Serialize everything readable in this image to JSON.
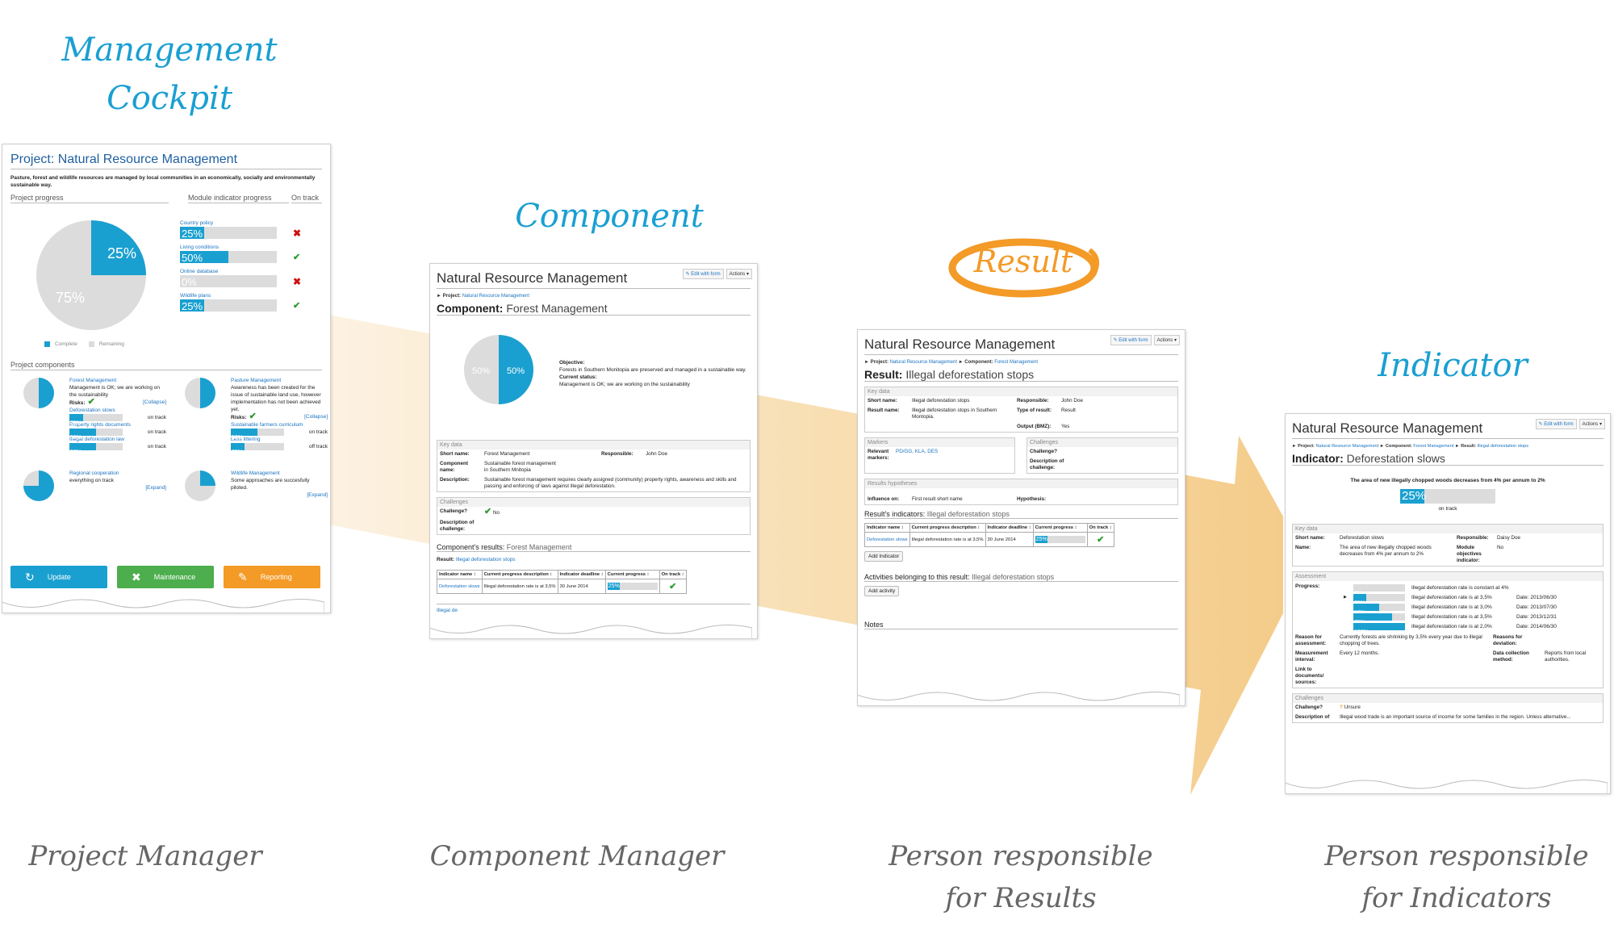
{
  "stages": {
    "management_cockpit": "Management\nCockpit",
    "management_cockpit_line1": "Management",
    "management_cockpit_line2": "Cockpit",
    "component": "Component",
    "result": "Result",
    "indicator": "Indicator"
  },
  "roles": {
    "project_manager": "Project Manager",
    "component_manager": "Component Manager",
    "results_line1": "Person responsible",
    "results_line2": "for Results",
    "indicators_line1": "Person responsible",
    "indicators_line2": "for Indicators"
  },
  "colors": {
    "accent_blue": "#1aa0d0",
    "result_orange": "#f39a27",
    "arrow_fill": "#f6d9a6",
    "update_button": "#1aa0d0",
    "maintenance_button": "#4cae4c",
    "reporting_button": "#f39a27"
  },
  "cockpit": {
    "title": "Project: Natural Resource Management",
    "description": "Pasture, forest and wildlife resources are managed by local communities in an economically, socially and environmentally sustainable way.",
    "project_progress_label": "Project progress",
    "module_indicator_label": "Module indicator progress",
    "on_track_label": "On track",
    "pie": {
      "complete_pct": 25,
      "remaining_pct": 75,
      "complete_label": "25%",
      "remaining_label": "75%"
    },
    "legend": {
      "complete": "Complete",
      "remaining": "Remaining"
    },
    "modules": [
      {
        "name": "Country policy",
        "progress": 25,
        "label": "25%",
        "on_track": false
      },
      {
        "name": "Living conditions",
        "progress": 50,
        "label": "50%",
        "on_track": true
      },
      {
        "name": "Online database",
        "progress": 0,
        "label": "0%",
        "on_track": false
      },
      {
        "name": "Wildlife plans",
        "progress": 25,
        "label": "25%",
        "on_track": true
      }
    ],
    "components_label": "Project components",
    "components": [
      {
        "name": "Forest Management",
        "progress": 50,
        "status": "Management is OK; we are working on the sustainability",
        "risks_label": "Risks:",
        "toggle": "[Collapse]",
        "indicators": [
          {
            "name": "Deforestation slows",
            "progress": 25,
            "label": "25%",
            "track": "on track"
          },
          {
            "name": "Property rights documents",
            "progress": 50,
            "label": "50%",
            "track": "on track"
          },
          {
            "name": "Illegal deforestation law",
            "progress": 50,
            "label": "50%",
            "track": "on track"
          }
        ]
      },
      {
        "name": "Pasture Management",
        "progress": 50,
        "status": "Awareness has been created for the issue of sustainable land use, however implementation has not been achieved yet.",
        "risks_label": "Risks:",
        "toggle": "[Collapse]",
        "indicators": [
          {
            "name": "Sustainable farmers curriculum",
            "progress": 50,
            "label": "50%",
            "track": "on track"
          },
          {
            "name": "Less littering",
            "progress": 25,
            "label": "25%",
            "track": "off track"
          }
        ]
      },
      {
        "name": "Regional cooperation",
        "progress": 75,
        "status": "everything on track",
        "toggle": "[Expand]",
        "indicators": []
      },
      {
        "name": "Wildlife Management",
        "progress": 25,
        "status": "Some approaches are succesfully piloted.",
        "toggle": "[Expand]",
        "indicators": []
      }
    ],
    "buttons": {
      "update": "Update",
      "maintenance": "Maintenance",
      "reporting": "Reporting"
    }
  },
  "component_page": {
    "app_title": "Natural Resource Management",
    "edit_button": "Edit with form",
    "actions_button": "Actions",
    "crumb_project_label": "Project:",
    "crumb_project": "Natural Resource Management",
    "heading_label": "Component:",
    "heading_value": "Forest Management",
    "pie": {
      "complete_pct": 50,
      "complete_label": "50%",
      "remaining_label": "50%"
    },
    "objective_label": "Objective:",
    "objective": "Forests in Southern Monitopia are preserved and managed in a sustainable way.",
    "status_label": "Current status:",
    "status": "Management is OK; we are working on the sustainability",
    "key_data": {
      "header": "Key data",
      "short_name_label": "Short name:",
      "short_name": "Forest Management",
      "responsible_label": "Responsible:",
      "responsible": "John Doe",
      "component_name_label": "Component name:",
      "component_name": "Sustainable forest management in Southern Mnitopia",
      "description_label": "Description:",
      "description": "Sustainable forest management requires clearly assigned (community) property rights, awareness and skills and passing and enforcing of laws against illegal deforestation."
    },
    "challenges": {
      "header": "Challenges",
      "challenge_label": "Challenge?",
      "challenge_value": "No",
      "description_label": "Description of challenge:"
    },
    "results_heading": "Component's results:",
    "results_heading_value": "Forest Management",
    "result_label": "Result:",
    "result_value": "Illegal deforestation stops",
    "table": {
      "headers": [
        "Indicator name",
        "Current progress description",
        "Indicator deadline",
        "Current progress",
        "On track"
      ],
      "rows": [
        {
          "name": "Deforestation slows",
          "description": "Illegal deforestation rate is at 3,5%",
          "deadline": "30 June 2014",
          "progress": 25,
          "label": "25%",
          "on_track": true
        }
      ]
    },
    "trailing_result": "Illegal de"
  },
  "result_page": {
    "app_title": "Natural Resource Management",
    "edit_button": "Edit with form",
    "actions_button": "Actions",
    "crumb_project_label": "Project:",
    "crumb_project": "Natural Resource Management",
    "crumb_component_label": "Component:",
    "crumb_component": "Forest Management",
    "heading_label": "Result:",
    "heading_value": "Illegal deforestation stops",
    "key_data": {
      "header": "Key data",
      "short_name_label": "Short name:",
      "short_name": "Illegal deforestation stops",
      "responsible_label": "Responsible:",
      "responsible": "John Doe",
      "result_name_label": "Result name:",
      "result_name": "Illegal deforestation stops in Southern Montopia.",
      "type_label": "Type of result:",
      "type": "Result",
      "output_label": "Output (BMZ):",
      "output": "Yes"
    },
    "markers": {
      "header": "Markers",
      "relevant_label": "Relevant markers:",
      "relevant": "PD/GG, KLA, DES"
    },
    "challenges": {
      "header": "Challenges",
      "challenge_label": "Challenge?",
      "description_label": "Description of challenge:"
    },
    "hypotheses": {
      "header": "Results hypotheses",
      "influence_label": "Influence on:",
      "influence": "First result short name",
      "hypothesis_label": "Hypothesis:"
    },
    "indicators_heading": "Result's indicators:",
    "indicators_heading_value": "Illegal deforestation stops",
    "table": {
      "headers": [
        "Indicator name",
        "Current progress description",
        "Indicator deadline",
        "Current progress",
        "On track"
      ],
      "rows": [
        {
          "name": "Deforestation slows",
          "description": "Illegal deforestation rate is at 3,5%",
          "deadline": "30 June 2014",
          "progress": 25,
          "label": "25%",
          "on_track": true
        }
      ]
    },
    "add_indicator": "Add Indicator",
    "activities_heading": "Activities belonging to this result:",
    "activities_heading_value": "Illegal deforestation stops",
    "add_activity": "Add activity",
    "notes_heading": "Notes"
  },
  "indicator_page": {
    "app_title": "Natural Resource Management",
    "edit_button": "Edit with form",
    "actions_button": "Actions",
    "crumb_project_label": "Project:",
    "crumb_project": "Natural Resource Management",
    "crumb_component_label": "Component:",
    "crumb_component": "Forest Management",
    "crumb_result_label": "Result:",
    "crumb_result": "Illegal deforestation stops",
    "heading_label": "Indicator:",
    "heading_value": "Deforestation slows",
    "target_text": "The area of new illegally chopped woods decreases from 4% per annum to 2%",
    "progress": 25,
    "progress_label": "25%",
    "track": "on track",
    "key_data": {
      "header": "Key data",
      "short_name_label": "Short name:",
      "short_name": "Deforestation slows",
      "responsible_label": "Responsible:",
      "responsible": "Daisy Doe",
      "name_label": "Name:",
      "name": "The area of new illegally chopped woods decreases from 4% per annum to 2%",
      "module_label": "Module objectives indicator:",
      "module": "No"
    },
    "assessment": {
      "header": "Assessment",
      "progress_label": "Progress:",
      "steps": [
        {
          "progress": 0,
          "label": "0%",
          "text": "Illegal deforestation rate is constant at 4%",
          "date": "",
          "current": false
        },
        {
          "progress": 25,
          "label": "25%",
          "text": "Illegal deforestation rate is at 3,5%",
          "date": "Date: 2013/06/30",
          "current": true
        },
        {
          "progress": 50,
          "label": "50%",
          "text": "Illegal deforestation rate is at 3,0%",
          "date": "Date: 2013/07/30",
          "current": false
        },
        {
          "progress": 75,
          "label": "75%",
          "text": "Illegal deforestation rate is at 3,5%",
          "date": "Date: 2013/12/31",
          "current": false
        },
        {
          "progress": 100,
          "label": "100%",
          "text": "Illegal deforestation rate is at 2,0%",
          "date": "Date: 2014/06/30",
          "current": false
        }
      ],
      "reason_label": "Reason for assessment:",
      "reason": "Currently forests are shrinking by 3,5% every year due to illegal chopping of trees.",
      "deviation_label": "Reasons for deviation:",
      "interval_label": "Measurement interval:",
      "interval": "Every 12 months.",
      "method_label": "Data collection method:",
      "method": "Reports from local authorities.",
      "link_label": "Link to documents/ sources:"
    },
    "challenges": {
      "header": "Challenges",
      "challenge_label": "Challenge?",
      "challenge_value": "Unsure",
      "description_label": "Description of",
      "description": "Illegal wood trade is an important source of income for some families in the region. Unless alternative..."
    }
  }
}
